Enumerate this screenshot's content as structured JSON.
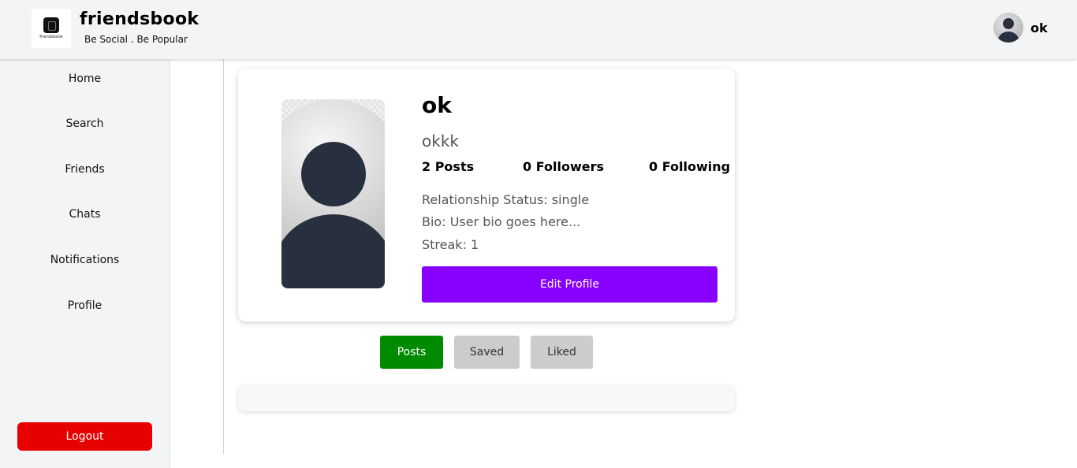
{
  "header": {
    "brand_name": "friendsbook",
    "tagline": "Be Social . Be Popular",
    "logo_text": "friendsbook",
    "user_name": "ok"
  },
  "sidebar": {
    "items": [
      {
        "label": "Home"
      },
      {
        "label": "Search"
      },
      {
        "label": "Friends"
      },
      {
        "label": "Chats"
      },
      {
        "label": "Notifications"
      },
      {
        "label": "Profile"
      }
    ],
    "logout_label": "Logout"
  },
  "profile": {
    "name": "ok",
    "username": "okkk",
    "posts": "2 Posts",
    "followers": "0 Followers",
    "following": "0 Following",
    "relationship": "Relationship Status: single",
    "bio": "Bio: User bio goes here...",
    "streak": "Streak: 1",
    "edit_label": "Edit Profile"
  },
  "tabs": {
    "posts": "Posts",
    "saved": "Saved",
    "liked": "Liked",
    "active": "Posts"
  },
  "colors": {
    "edit_button": "#8800ff",
    "logout_button": "#e60000",
    "active_tab": "#008a00",
    "inactive_tab": "#cccccc"
  }
}
